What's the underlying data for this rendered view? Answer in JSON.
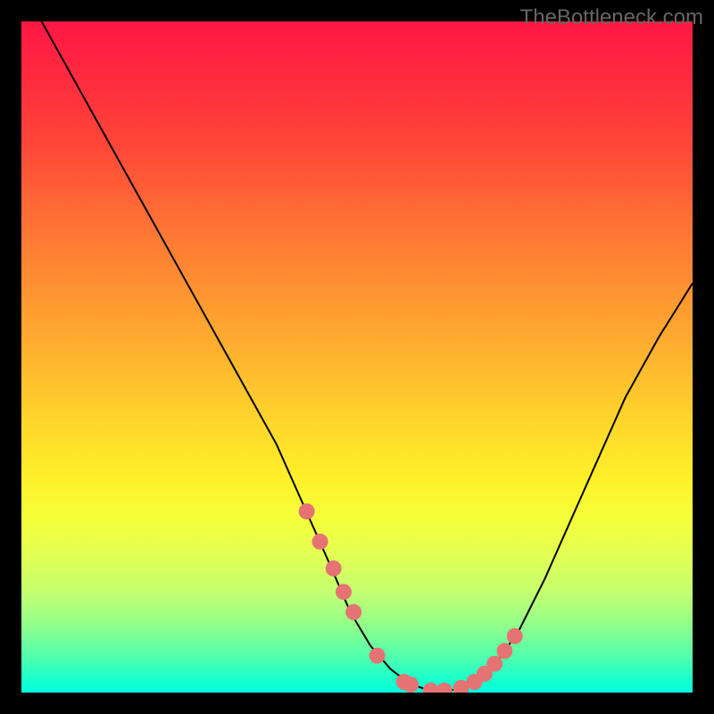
{
  "watermark": "TheBottleneck.com",
  "chart_data": {
    "type": "line",
    "title": "",
    "xlabel": "",
    "ylabel": "",
    "xlim": [
      0,
      100
    ],
    "ylim": [
      0,
      100
    ],
    "series": [
      {
        "name": "curve",
        "x": [
          3,
          8,
          13,
          18,
          23,
          28,
          33,
          38,
          42,
          46,
          49,
          52,
          55,
          58,
          61,
          64,
          67,
          70,
          74,
          78,
          82,
          86,
          90,
          95,
          100
        ],
        "y": [
          100,
          91,
          82,
          73,
          64,
          55,
          46,
          37,
          28,
          19,
          12,
          7,
          3.5,
          1.2,
          0.3,
          0.3,
          1.2,
          3.5,
          9,
          17,
          26,
          35,
          44,
          53,
          61
        ]
      }
    ],
    "markers": {
      "name": "highlighted-points",
      "color": "#e57373",
      "x": [
        42.5,
        44.5,
        46.5,
        48.0,
        49.5,
        53.0,
        57.0,
        58.0,
        61.0,
        63.0,
        65.5,
        67.5,
        69.0,
        70.5,
        72.0,
        73.5
      ],
      "y": [
        27.0,
        22.5,
        18.5,
        15.0,
        12.0,
        5.5,
        1.6,
        1.2,
        0.3,
        0.3,
        0.7,
        1.6,
        2.8,
        4.3,
        6.2,
        8.4
      ]
    },
    "gradient_stops": [
      {
        "pct": 0,
        "color": "#ff1744"
      },
      {
        "pct": 18,
        "color": "#ff4538"
      },
      {
        "pct": 38,
        "color": "#ff8c32"
      },
      {
        "pct": 58,
        "color": "#ffd02c"
      },
      {
        "pct": 74,
        "color": "#f5ff3a"
      },
      {
        "pct": 90,
        "color": "#90ff8a"
      },
      {
        "pct": 100,
        "color": "#00ffdd"
      }
    ]
  }
}
